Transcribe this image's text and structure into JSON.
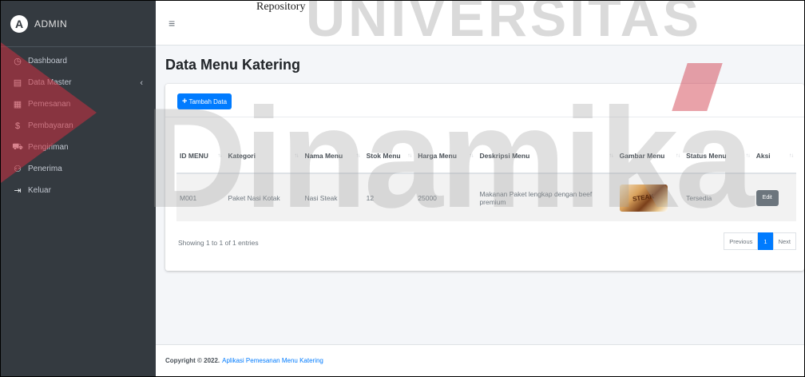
{
  "brand": {
    "logo_letter": "A",
    "name": "ADMIN"
  },
  "sidebar": {
    "items": [
      {
        "icon": "dashboard-icon",
        "glyph": "◷",
        "label": "Dashboard"
      },
      {
        "icon": "database-icon",
        "glyph": "▤",
        "label": "Data Master",
        "arrow": "‹"
      },
      {
        "icon": "cart-icon",
        "glyph": "▦",
        "label": "Pemesanan"
      },
      {
        "icon": "dollar-icon",
        "glyph": "$",
        "label": "Pembayaran"
      },
      {
        "icon": "truck-icon",
        "glyph": "⛟",
        "label": "Pengiriman"
      },
      {
        "icon": "users-icon",
        "glyph": "⚇",
        "label": "Penerima"
      },
      {
        "icon": "logout-icon",
        "glyph": "⇥",
        "label": "Keluar"
      }
    ]
  },
  "topbar": {
    "menu_glyph": "≡"
  },
  "page": {
    "title": "Data Menu Katering"
  },
  "card": {
    "add_button_plus": "+",
    "add_button_label": "Tambah Data"
  },
  "table": {
    "columns": [
      {
        "label": "ID MENU"
      },
      {
        "label": "Kategori"
      },
      {
        "label": "Nama Menu"
      },
      {
        "label": "Stok Menu"
      },
      {
        "label": "Harga Menu"
      },
      {
        "label": "Deskripsi Menu"
      },
      {
        "label": "Gambar Menu"
      },
      {
        "label": "Status Menu"
      },
      {
        "label": "Aksi"
      }
    ],
    "rows": [
      {
        "id": "M001",
        "kategori": "Paket Nasi Kotak",
        "nama": "Nasi Steak",
        "stok": "12",
        "harga": "25000",
        "deskripsi": "Makanan Paket lengkap dengan beef premium",
        "gambar_text": "STEAK",
        "status": "Tersedia",
        "aksi": "Edit"
      }
    ]
  },
  "pagination": {
    "info": "Showing 1 to 1 of 1 entries",
    "previous": "Previous",
    "page": "1",
    "next": "Next"
  },
  "footer": {
    "copyright": "Copyright © 2022.",
    "app_name": "Aplikasi Pemesanan Menu Katering"
  },
  "watermark": {
    "top": "UNIVERSITAS",
    "main": "Dinamika",
    "caption": "Repository"
  },
  "colors": {
    "primary": "#007bff",
    "sidebar": "#343a40",
    "watermark_red": "#ce3040"
  }
}
